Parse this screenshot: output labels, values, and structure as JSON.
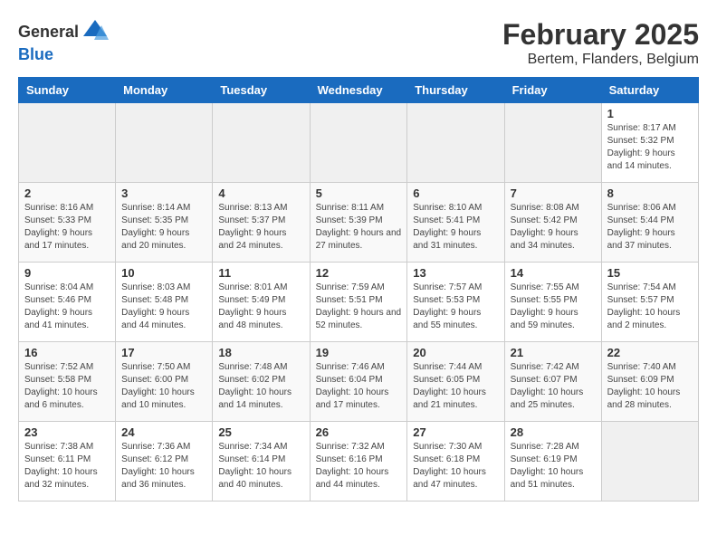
{
  "header": {
    "logo_general": "General",
    "logo_blue": "Blue",
    "title": "February 2025",
    "subtitle": "Bertem, Flanders, Belgium"
  },
  "columns": [
    "Sunday",
    "Monday",
    "Tuesday",
    "Wednesday",
    "Thursday",
    "Friday",
    "Saturday"
  ],
  "weeks": [
    {
      "days": [
        {
          "num": "",
          "info": ""
        },
        {
          "num": "",
          "info": ""
        },
        {
          "num": "",
          "info": ""
        },
        {
          "num": "",
          "info": ""
        },
        {
          "num": "",
          "info": ""
        },
        {
          "num": "",
          "info": ""
        },
        {
          "num": "1",
          "info": "Sunrise: 8:17 AM\nSunset: 5:32 PM\nDaylight: 9 hours and 14 minutes."
        }
      ]
    },
    {
      "days": [
        {
          "num": "2",
          "info": "Sunrise: 8:16 AM\nSunset: 5:33 PM\nDaylight: 9 hours and 17 minutes."
        },
        {
          "num": "3",
          "info": "Sunrise: 8:14 AM\nSunset: 5:35 PM\nDaylight: 9 hours and 20 minutes."
        },
        {
          "num": "4",
          "info": "Sunrise: 8:13 AM\nSunset: 5:37 PM\nDaylight: 9 hours and 24 minutes."
        },
        {
          "num": "5",
          "info": "Sunrise: 8:11 AM\nSunset: 5:39 PM\nDaylight: 9 hours and 27 minutes."
        },
        {
          "num": "6",
          "info": "Sunrise: 8:10 AM\nSunset: 5:41 PM\nDaylight: 9 hours and 31 minutes."
        },
        {
          "num": "7",
          "info": "Sunrise: 8:08 AM\nSunset: 5:42 PM\nDaylight: 9 hours and 34 minutes."
        },
        {
          "num": "8",
          "info": "Sunrise: 8:06 AM\nSunset: 5:44 PM\nDaylight: 9 hours and 37 minutes."
        }
      ]
    },
    {
      "days": [
        {
          "num": "9",
          "info": "Sunrise: 8:04 AM\nSunset: 5:46 PM\nDaylight: 9 hours and 41 minutes."
        },
        {
          "num": "10",
          "info": "Sunrise: 8:03 AM\nSunset: 5:48 PM\nDaylight: 9 hours and 44 minutes."
        },
        {
          "num": "11",
          "info": "Sunrise: 8:01 AM\nSunset: 5:49 PM\nDaylight: 9 hours and 48 minutes."
        },
        {
          "num": "12",
          "info": "Sunrise: 7:59 AM\nSunset: 5:51 PM\nDaylight: 9 hours and 52 minutes."
        },
        {
          "num": "13",
          "info": "Sunrise: 7:57 AM\nSunset: 5:53 PM\nDaylight: 9 hours and 55 minutes."
        },
        {
          "num": "14",
          "info": "Sunrise: 7:55 AM\nSunset: 5:55 PM\nDaylight: 9 hours and 59 minutes."
        },
        {
          "num": "15",
          "info": "Sunrise: 7:54 AM\nSunset: 5:57 PM\nDaylight: 10 hours and 2 minutes."
        }
      ]
    },
    {
      "days": [
        {
          "num": "16",
          "info": "Sunrise: 7:52 AM\nSunset: 5:58 PM\nDaylight: 10 hours and 6 minutes."
        },
        {
          "num": "17",
          "info": "Sunrise: 7:50 AM\nSunset: 6:00 PM\nDaylight: 10 hours and 10 minutes."
        },
        {
          "num": "18",
          "info": "Sunrise: 7:48 AM\nSunset: 6:02 PM\nDaylight: 10 hours and 14 minutes."
        },
        {
          "num": "19",
          "info": "Sunrise: 7:46 AM\nSunset: 6:04 PM\nDaylight: 10 hours and 17 minutes."
        },
        {
          "num": "20",
          "info": "Sunrise: 7:44 AM\nSunset: 6:05 PM\nDaylight: 10 hours and 21 minutes."
        },
        {
          "num": "21",
          "info": "Sunrise: 7:42 AM\nSunset: 6:07 PM\nDaylight: 10 hours and 25 minutes."
        },
        {
          "num": "22",
          "info": "Sunrise: 7:40 AM\nSunset: 6:09 PM\nDaylight: 10 hours and 28 minutes."
        }
      ]
    },
    {
      "days": [
        {
          "num": "23",
          "info": "Sunrise: 7:38 AM\nSunset: 6:11 PM\nDaylight: 10 hours and 32 minutes."
        },
        {
          "num": "24",
          "info": "Sunrise: 7:36 AM\nSunset: 6:12 PM\nDaylight: 10 hours and 36 minutes."
        },
        {
          "num": "25",
          "info": "Sunrise: 7:34 AM\nSunset: 6:14 PM\nDaylight: 10 hours and 40 minutes."
        },
        {
          "num": "26",
          "info": "Sunrise: 7:32 AM\nSunset: 6:16 PM\nDaylight: 10 hours and 44 minutes."
        },
        {
          "num": "27",
          "info": "Sunrise: 7:30 AM\nSunset: 6:18 PM\nDaylight: 10 hours and 47 minutes."
        },
        {
          "num": "28",
          "info": "Sunrise: 7:28 AM\nSunset: 6:19 PM\nDaylight: 10 hours and 51 minutes."
        },
        {
          "num": "",
          "info": ""
        }
      ]
    }
  ]
}
